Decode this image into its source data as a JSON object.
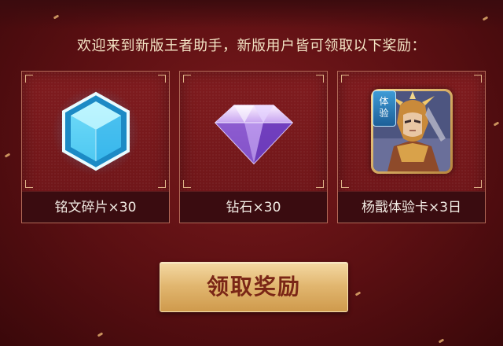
{
  "headline": "欢迎来到新版王者助手，新版用户皆可领取以下奖励：",
  "rewards": [
    {
      "label": "铭文碎片×30",
      "icon": "inscription-shard-crystal-icon"
    },
    {
      "label": "钻石×30",
      "icon": "diamond-gem-icon"
    },
    {
      "label": "杨戬体验卡×3日",
      "icon": "hero-yangjian-portrait",
      "tag": [
        "体",
        "验"
      ]
    }
  ],
  "claim_button": "领取奖励",
  "colors": {
    "background": "#6a1417",
    "accent_gold": "#e1b66f",
    "button_text": "#7a2616",
    "label_bar": "#3a0c10"
  }
}
